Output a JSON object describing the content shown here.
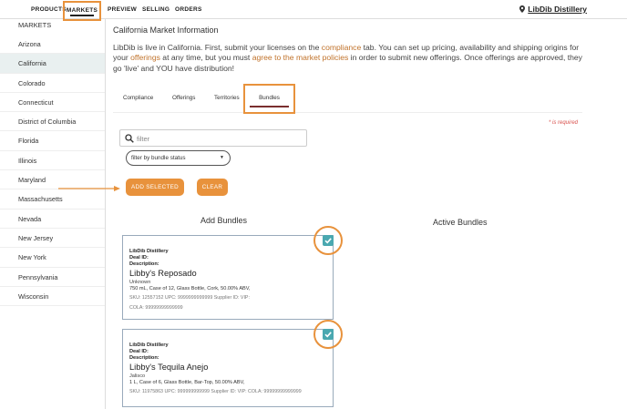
{
  "nav": {
    "products": "PRODUCTS",
    "markets": "MARKETS",
    "preview": "PREVIEW",
    "selling": "SELLING",
    "orders": "ORDERS",
    "brand": "LibDib Distillery"
  },
  "sidebar": {
    "heading": "MARKETS",
    "items": [
      {
        "label": "Arizona"
      },
      {
        "label": "California"
      },
      {
        "label": "Colorado"
      },
      {
        "label": "Connecticut"
      },
      {
        "label": "District of Columbia"
      },
      {
        "label": "Florida"
      },
      {
        "label": "Illinois"
      },
      {
        "label": "Maryland"
      },
      {
        "label": "Massachusetts"
      },
      {
        "label": "Nevada"
      },
      {
        "label": "New Jersey"
      },
      {
        "label": "New York"
      },
      {
        "label": "Pennsylvania"
      },
      {
        "label": "Wisconsin"
      }
    ],
    "active": "California"
  },
  "main": {
    "title": "California Market Information",
    "intro": {
      "p1": "LibDib is live in California. First, submit your licenses on the ",
      "link1": "compliance",
      "p2": " tab. You can set up pricing, availability and shipping origins for your ",
      "link2": "offerings",
      "p3": " at any time, but you must ",
      "link3": "agree to the market policies",
      "p4": " in order to submit new offerings. Once offerings are approved, they go 'live' and YOU have distribution!"
    },
    "tabs": {
      "compliance": "Compliance",
      "offerings": "Offerings",
      "territories": "Territories",
      "bundles": "Bundles"
    },
    "required_note": "* is required",
    "filter_placeholder": "filter",
    "status_select": "filter by bundle status",
    "add_selected": "ADD SELECTED",
    "clear": "CLEAR",
    "add_bundles_heading": "Add Bundles",
    "active_bundles_heading": "Active Bundles",
    "cards": [
      {
        "distillery": "LibDib Distillery",
        "deal_id": "Deal ID:",
        "description": "Description:",
        "name": "Libby's Reposado",
        "origin": "Unknown",
        "detail": "750 mL, Case of 12, Glass Bottle, Cork, 50.00% ABV,",
        "ids": "SKU: 12557152   UPC: 9999999999999   Supplier ID:   VIP:",
        "cola": "COLA: 99999999999999",
        "checked": true
      },
      {
        "distillery": "LibDib Distillery",
        "deal_id": "Deal ID:",
        "description": "Description:",
        "name": "Libby's Tequila Anejo",
        "origin": "Jalisco",
        "detail": "1 L, Case of 6, Glass Bottle, Bar-Top, 50.00% ABV,",
        "ids": "SKU: 11975863   UPC: 999999999999   Supplier ID:   VIP:   COLA: 99999999999999",
        "cola": "",
        "checked": true
      }
    ]
  },
  "colors": {
    "accent": "#e8923c",
    "link": "#c0722a",
    "checkbox": "#4aa8b0",
    "active_row": "#e9f0f0"
  }
}
